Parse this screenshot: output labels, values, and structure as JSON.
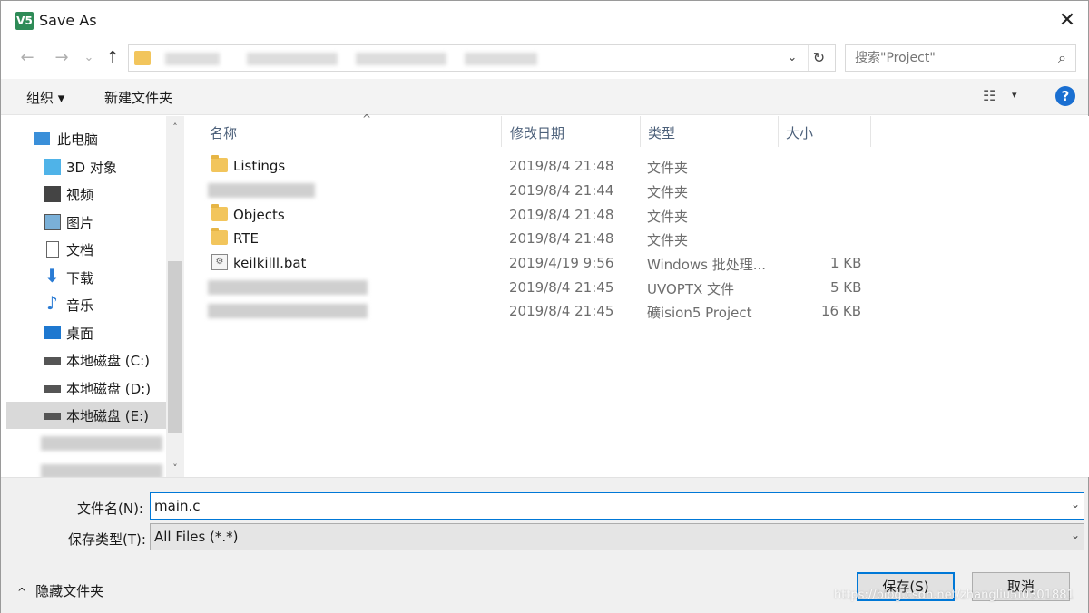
{
  "window": {
    "title": "Save As",
    "app_icon": "V5",
    "close_glyph": "✕"
  },
  "nav": {
    "back": "←",
    "forward": "→",
    "recent": "⌄",
    "up": "↑",
    "dropdown": "⌄",
    "refresh": "↻"
  },
  "search": {
    "placeholder": "搜索\"Project\"",
    "icon": "⌕"
  },
  "toolbar": {
    "organize": "组织 ▾",
    "new_folder": "新建文件夹",
    "view_icon": "☷",
    "view_dd": "▾",
    "help": "?"
  },
  "sidebar": {
    "items": [
      {
        "label": "此电脑",
        "icon": "pc-icon"
      },
      {
        "label": "3D 对象",
        "icon": "cube-icon"
      },
      {
        "label": "视频",
        "icon": "video-icon"
      },
      {
        "label": "图片",
        "icon": "picture-icon"
      },
      {
        "label": "文档",
        "icon": "document-icon"
      },
      {
        "label": "下载",
        "icon": "download-icon"
      },
      {
        "label": "音乐",
        "icon": "music-icon"
      },
      {
        "label": "桌面",
        "icon": "desktop-icon"
      },
      {
        "label": "本地磁盘 (C:)",
        "icon": "drive-icon"
      },
      {
        "label": "本地磁盘 (D:)",
        "icon": "drive-icon"
      },
      {
        "label": "本地磁盘 (E:)",
        "icon": "drive-icon",
        "selected": true
      }
    ],
    "scroll_up": "˄",
    "scroll_down": "˅"
  },
  "columns": {
    "name": "名称",
    "date": "修改日期",
    "type": "类型",
    "size": "大小",
    "sort_glyph": "^"
  },
  "files": [
    {
      "name": "Listings",
      "date": "2019/8/4 21:48",
      "type": "文件夹",
      "size": "",
      "kind": "folder"
    },
    {
      "name": "",
      "date": "2019/8/4 21:44",
      "type": "文件夹",
      "size": "",
      "kind": "blurred"
    },
    {
      "name": "Objects",
      "date": "2019/8/4 21:48",
      "type": "文件夹",
      "size": "",
      "kind": "folder"
    },
    {
      "name": "RTE",
      "date": "2019/8/4 21:48",
      "type": "文件夹",
      "size": "",
      "kind": "folder"
    },
    {
      "name": "keilkilll.bat",
      "date": "2019/4/19 9:56",
      "type": "Windows 批处理...",
      "size": "1 KB",
      "kind": "bat"
    },
    {
      "name": "",
      "date": "2019/8/4 21:45",
      "type": "UVOPTX 文件",
      "size": "5 KB",
      "kind": "blurred"
    },
    {
      "name": "",
      "date": "2019/8/4 21:45",
      "type": "礦ision5 Project",
      "size": "16 KB",
      "kind": "blurred"
    }
  ],
  "form": {
    "filename_label": "文件名(N):",
    "filename_value": "main.c",
    "filetype_label": "保存类型(T):",
    "filetype_value": "All Files (*.*)",
    "dropdown_glyph": "⌄"
  },
  "footer": {
    "hide_folders_caret": "^",
    "hide_folders": "隐藏文件夹",
    "save": "保存(S)",
    "cancel": "取消",
    "watermark": "https://blog.csdn.net/zhangliu5f0301881"
  }
}
